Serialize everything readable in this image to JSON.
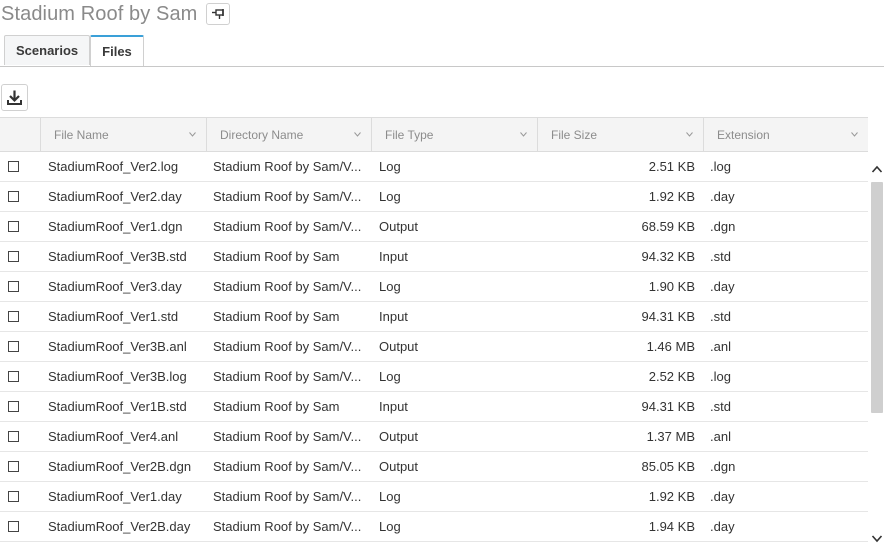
{
  "header": {
    "title": "Stadium Roof by Sam"
  },
  "tabs": [
    {
      "label": "Scenarios"
    },
    {
      "label": "Files"
    }
  ],
  "toolbar": {
    "download_icon": "download-icon",
    "pin_icon": "pin-icon"
  },
  "grid": {
    "columns": [
      "File Name",
      "Directory Name",
      "File Type",
      "File Size",
      "Extension"
    ],
    "rows": [
      {
        "name": "StadiumRoof_Ver2.log",
        "dir": "Stadium Roof by Sam/V...",
        "type": "Log",
        "size": "2.51 KB",
        "ext": ".log"
      },
      {
        "name": "StadiumRoof_Ver2.day",
        "dir": "Stadium Roof by Sam/V...",
        "type": "Log",
        "size": "1.92 KB",
        "ext": ".day"
      },
      {
        "name": "StadiumRoof_Ver1.dgn",
        "dir": "Stadium Roof by Sam/V...",
        "type": "Output",
        "size": "68.59 KB",
        "ext": ".dgn"
      },
      {
        "name": "StadiumRoof_Ver3B.std",
        "dir": "Stadium Roof by Sam",
        "type": "Input",
        "size": "94.32 KB",
        "ext": ".std"
      },
      {
        "name": "StadiumRoof_Ver3.day",
        "dir": "Stadium Roof by Sam/V...",
        "type": "Log",
        "size": "1.90 KB",
        "ext": ".day"
      },
      {
        "name": "StadiumRoof_Ver1.std",
        "dir": "Stadium Roof by Sam",
        "type": "Input",
        "size": "94.31 KB",
        "ext": ".std"
      },
      {
        "name": "StadiumRoof_Ver3B.anl",
        "dir": "Stadium Roof by Sam/V...",
        "type": "Output",
        "size": "1.46 MB",
        "ext": ".anl"
      },
      {
        "name": "StadiumRoof_Ver3B.log",
        "dir": "Stadium Roof by Sam/V...",
        "type": "Log",
        "size": "2.52 KB",
        "ext": ".log"
      },
      {
        "name": "StadiumRoof_Ver1B.std",
        "dir": "Stadium Roof by Sam",
        "type": "Input",
        "size": "94.31 KB",
        "ext": ".std"
      },
      {
        "name": "StadiumRoof_Ver4.anl",
        "dir": "Stadium Roof by Sam/V...",
        "type": "Output",
        "size": "1.37 MB",
        "ext": ".anl"
      },
      {
        "name": "StadiumRoof_Ver2B.dgn",
        "dir": "Stadium Roof by Sam/V...",
        "type": "Output",
        "size": "85.05 KB",
        "ext": ".dgn"
      },
      {
        "name": "StadiumRoof_Ver1.day",
        "dir": "Stadium Roof by Sam/V...",
        "type": "Log",
        "size": "1.92 KB",
        "ext": ".day"
      },
      {
        "name": "StadiumRoof_Ver2B.day",
        "dir": "Stadium Roof by Sam/V...",
        "type": "Log",
        "size": "1.94 KB",
        "ext": ".day"
      }
    ]
  },
  "colors": {
    "accent": "#3aa0d8",
    "header_bg": "#f4f4f4",
    "border": "#dcdcdc"
  }
}
